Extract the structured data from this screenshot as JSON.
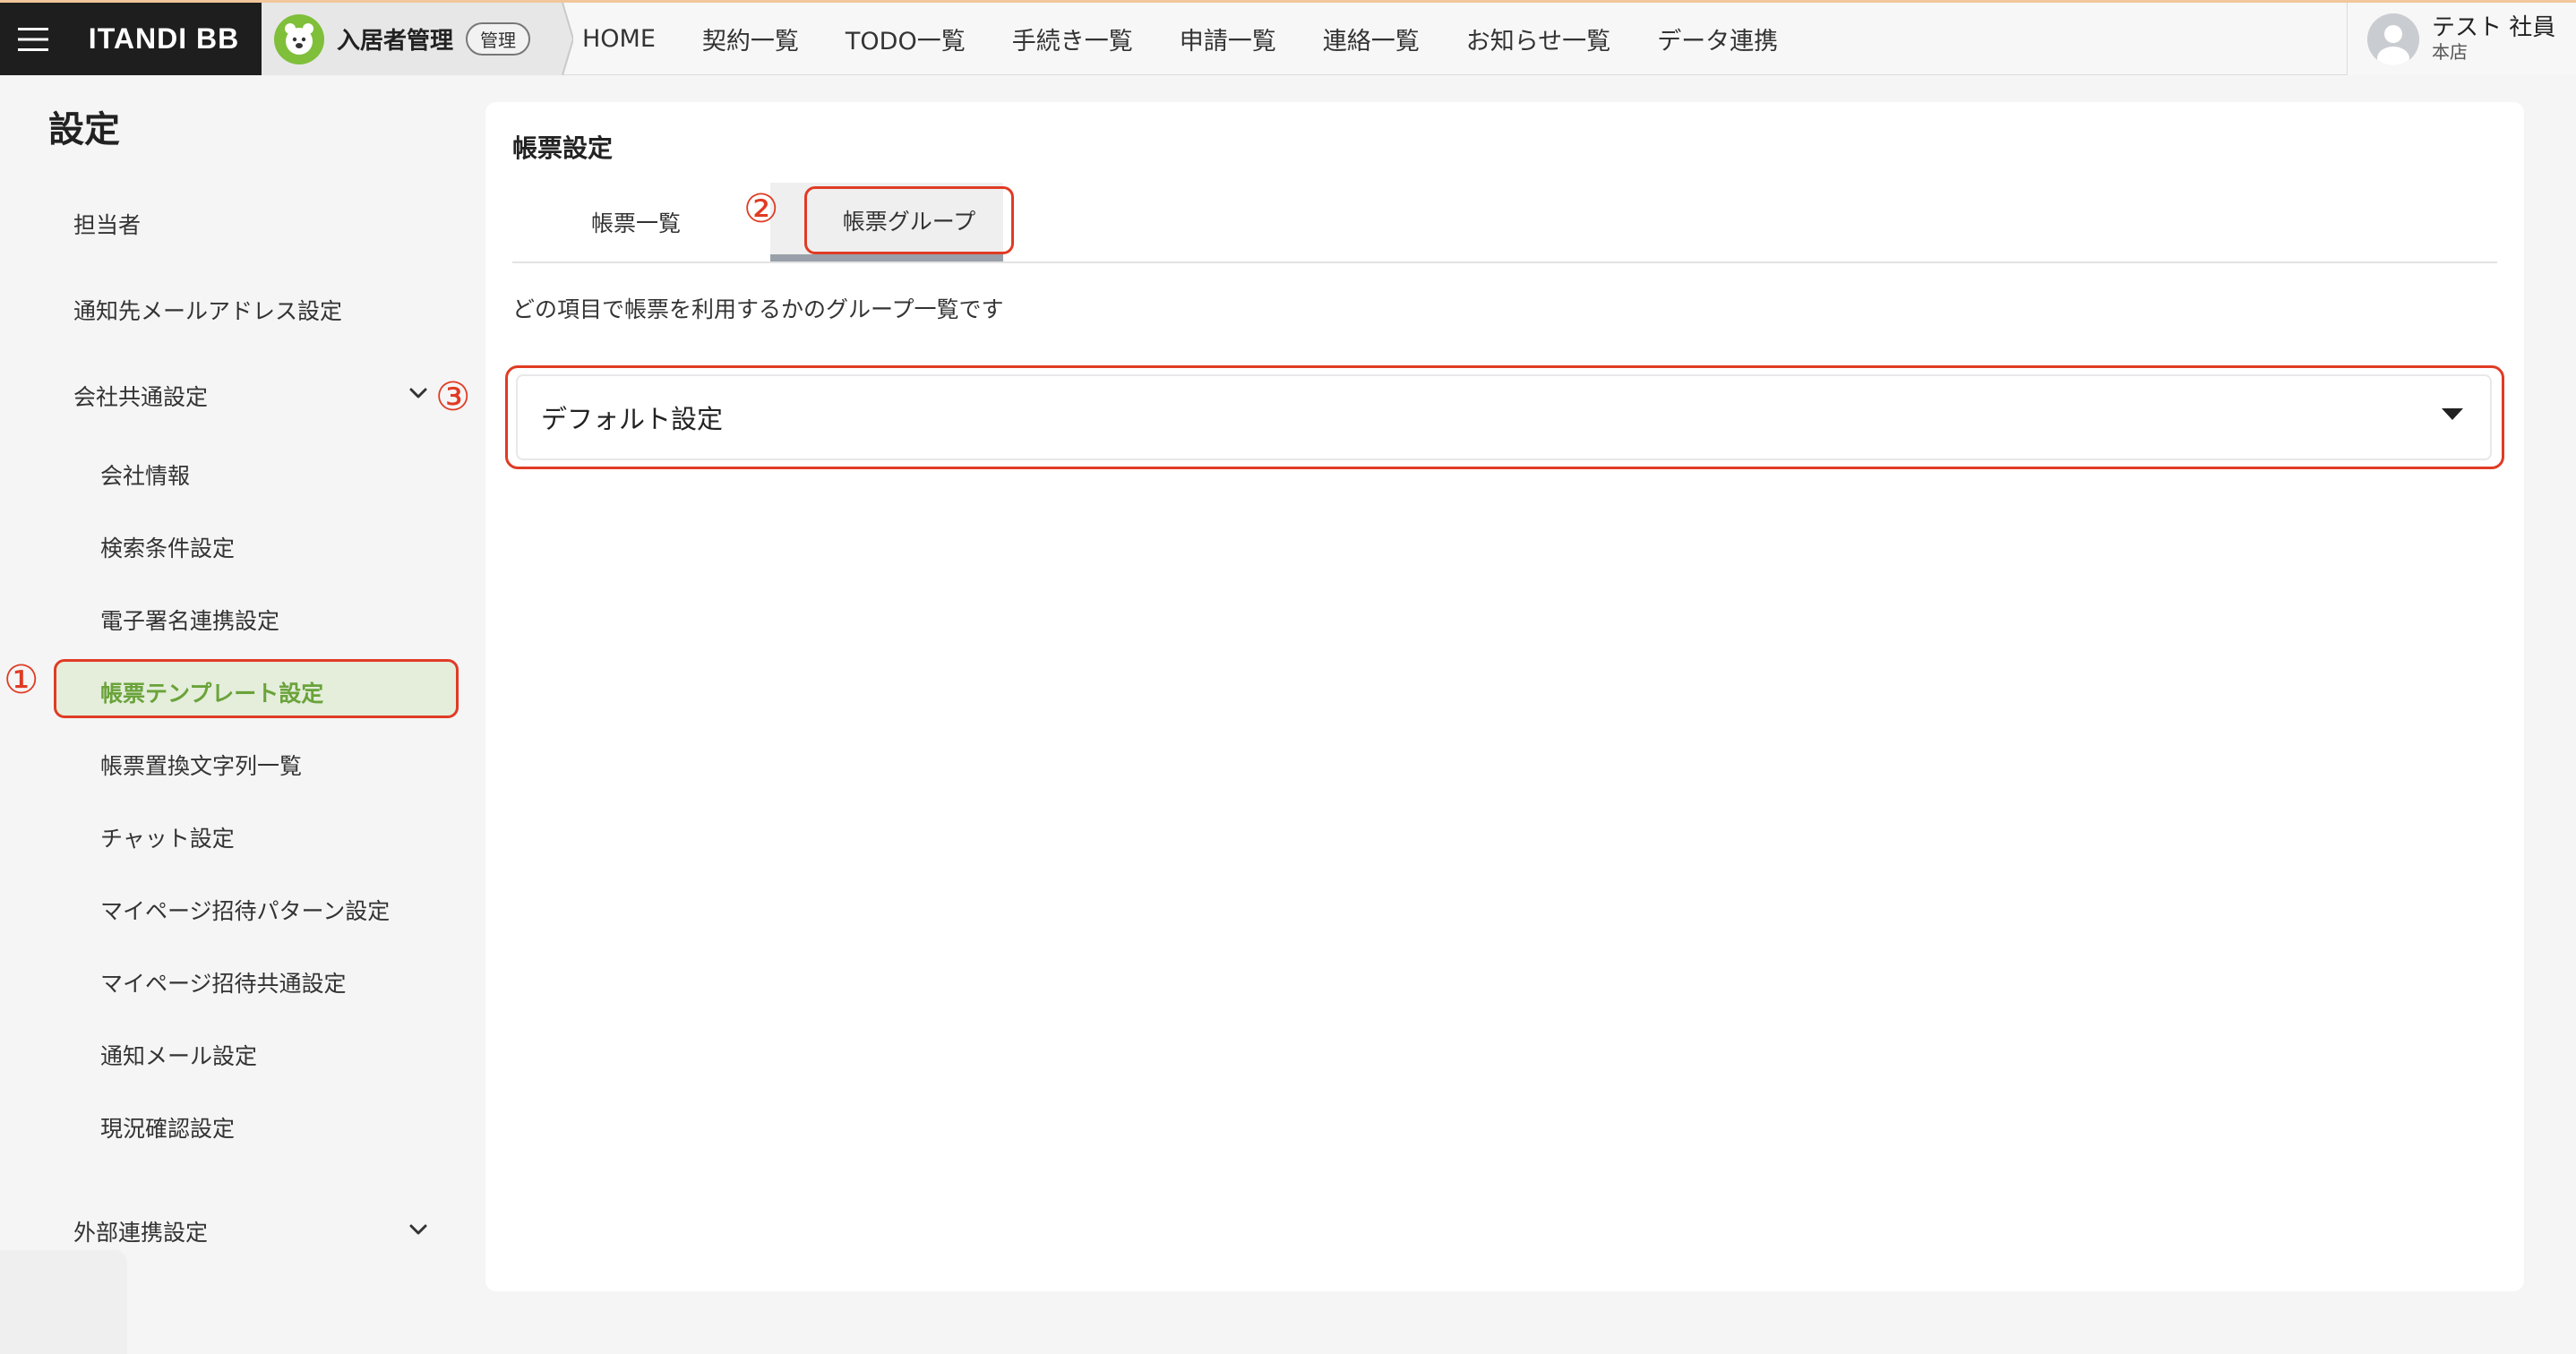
{
  "topbar": {
    "brand": "ITANDI BB",
    "app_name": "入居者管理",
    "app_badge": "管理",
    "nav": [
      "HOME",
      "契約一覧",
      "TODO一覧",
      "手続き一覧",
      "申請一覧",
      "連絡一覧",
      "お知らせ一覧",
      "データ連携"
    ],
    "user_name": "テスト 社員",
    "user_store": "本店"
  },
  "sidebar": {
    "title": "設定",
    "items": {
      "tantosha": "担当者",
      "notify_mail": "通知先メールアドレス設定",
      "company_common": "会社共通設定",
      "company_info": "会社情報",
      "search_cond": "検索条件設定",
      "esign": "電子署名連携設定",
      "doc_template": "帳票テンプレート設定",
      "replace_text": "帳票置換文字列一覧",
      "chat": "チャット設定",
      "mypage_pattern": "マイページ招待パターン設定",
      "mypage_common": "マイページ招待共通設定",
      "notify_mail_setting": "通知メール設定",
      "status_check": "現況確認設定",
      "external": "外部連携設定"
    }
  },
  "main": {
    "title": "帳票設定",
    "tabs": [
      "帳票一覧",
      "帳票グループ"
    ],
    "description": "どの項目で帳票を利用するかのグループ一覧です",
    "group_dropdown": "デフォルト設定"
  },
  "annotations": {
    "m1": "①",
    "m2": "②",
    "m3": "③"
  },
  "colors": {
    "highlight": "#e03b24",
    "active_text": "#6aa33a",
    "active_bg": "#e4eedb"
  },
  "icons": [
    "hamburger-icon",
    "app-logo-icon",
    "user-avatar-icon",
    "chevron-down-icon",
    "caret-down-icon"
  ]
}
